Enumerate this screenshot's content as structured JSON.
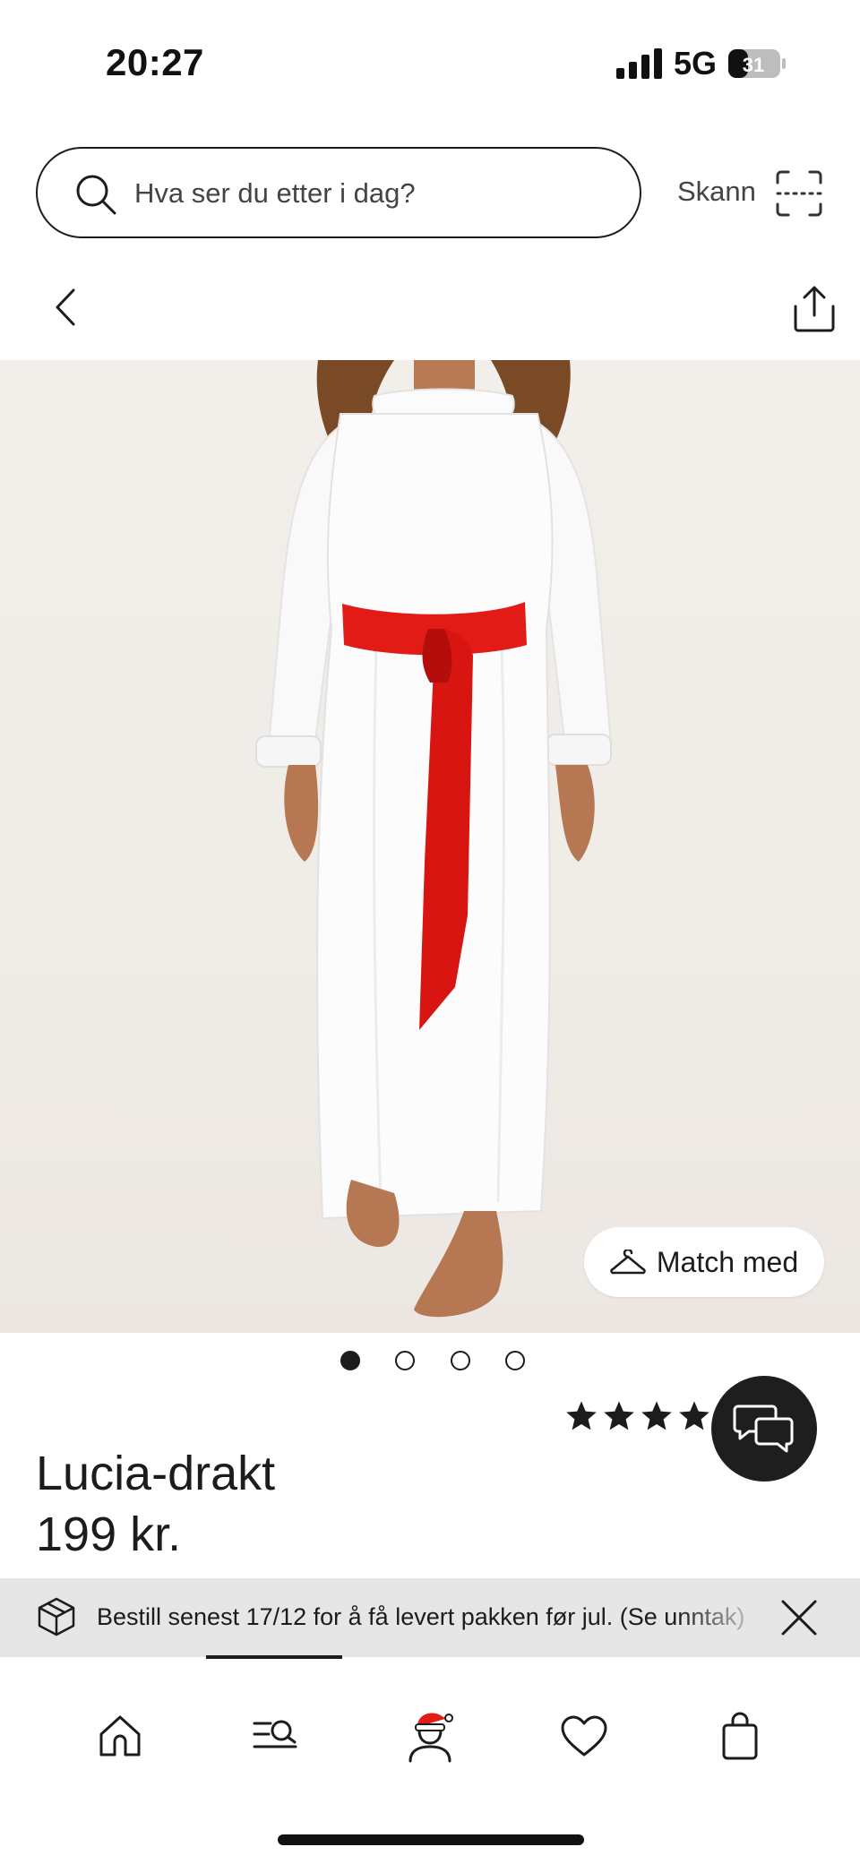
{
  "status_bar": {
    "time": "20:27",
    "network": "5G",
    "battery": "31"
  },
  "search": {
    "placeholder": "Hva ser du etter i dag?",
    "scan_label": "Skann"
  },
  "product": {
    "match_label": "Match med",
    "title": "Lucia-drakt",
    "price": "199 kr.",
    "image_count": 4,
    "active_image": 1,
    "rating_visible_stars": 4
  },
  "banner": {
    "text": "Bestill senest 17/12 for å få levert pakken før jul. (Se unntak)"
  },
  "tabbar": {
    "items": [
      {
        "icon": "home-icon"
      },
      {
        "icon": "browse-search-icon"
      },
      {
        "icon": "santa-profile-icon"
      },
      {
        "icon": "heart-icon"
      },
      {
        "icon": "shopping-bag-icon"
      }
    ]
  },
  "colors": {
    "ink": "#1c1c1c",
    "banner_bg": "#e6e6e6",
    "image_bg": "#efebe6",
    "sash_red": "#e31b17",
    "chat_bg": "#1e1e1e"
  }
}
